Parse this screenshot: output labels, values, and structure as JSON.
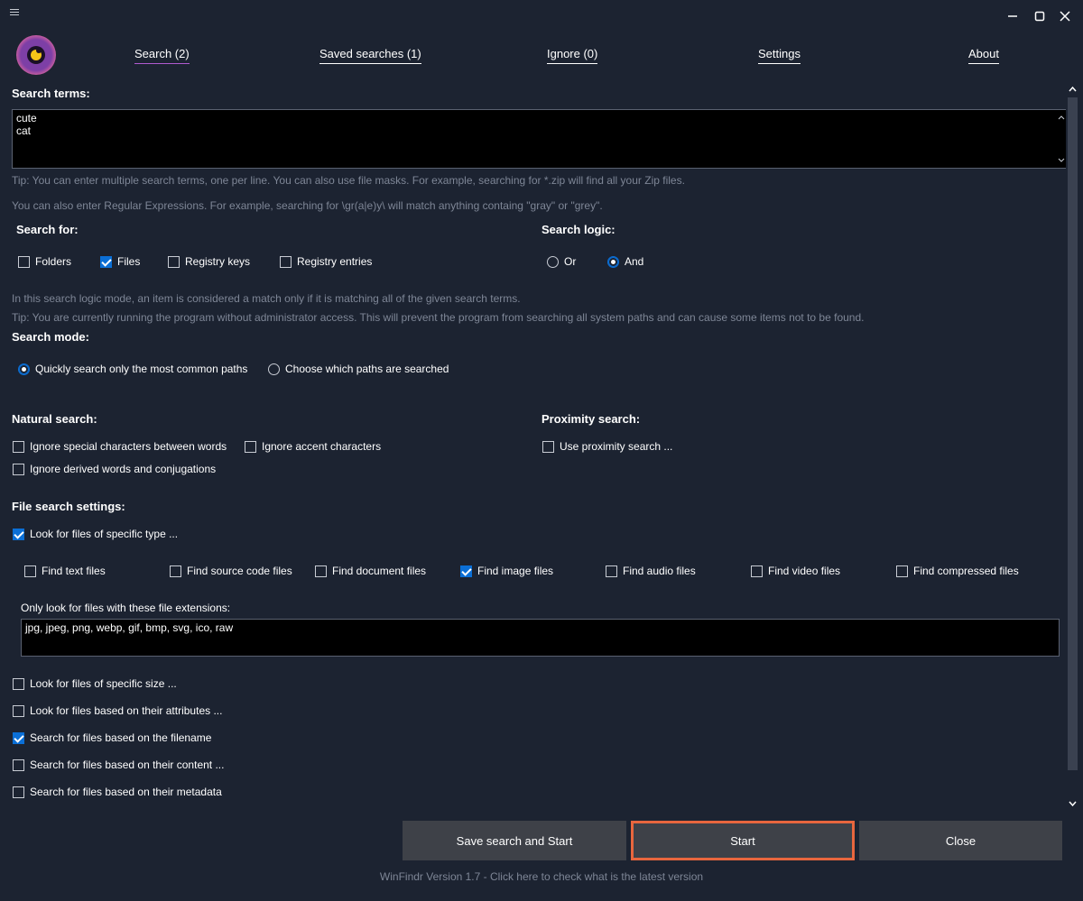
{
  "tabs": [
    {
      "label": "Search (2)"
    },
    {
      "label": "Saved searches (1)"
    },
    {
      "label": "Ignore (0)"
    },
    {
      "label": "Settings"
    },
    {
      "label": "About"
    }
  ],
  "search_terms": {
    "heading": "Search terms:",
    "value": "cute\ncat",
    "tip1": "Tip: You can enter multiple search terms, one per line. You can also use file masks. For example, searching for *.zip will find all your Zip files.",
    "tip2": "You can also enter Regular Expressions. For example, searching for \\gr(a|e)y\\ will match anything containg \"gray\" or \"grey\"."
  },
  "search_for": {
    "heading": "Search for:",
    "options": [
      {
        "label": "Folders",
        "checked": false
      },
      {
        "label": "Files",
        "checked": true
      },
      {
        "label": "Registry keys",
        "checked": false
      },
      {
        "label": "Registry entries",
        "checked": false
      }
    ]
  },
  "search_logic": {
    "heading": "Search logic:",
    "options": [
      {
        "label": "Or",
        "selected": false
      },
      {
        "label": "And",
        "selected": true
      }
    ],
    "info": "In this search logic mode, an item is considered a match only if it is matching all of the given search terms.",
    "admin_tip": "Tip: You are currently running the program without administrator access. This will prevent the program from searching all system paths and can cause some items not to be found."
  },
  "search_mode": {
    "heading": "Search mode:",
    "options": [
      {
        "label": "Quickly search only the most common paths",
        "selected": true
      },
      {
        "label": "Choose which paths are searched",
        "selected": false
      }
    ]
  },
  "natural_search": {
    "heading": "Natural search:",
    "options": [
      {
        "label": "Ignore special characters between words",
        "checked": false
      },
      {
        "label": "Ignore accent characters",
        "checked": false
      },
      {
        "label": "Ignore derived words and conjugations",
        "checked": false
      }
    ]
  },
  "proximity_search": {
    "heading": "Proximity search:",
    "options": [
      {
        "label": "Use proximity search ...",
        "checked": false
      }
    ]
  },
  "file_search": {
    "heading": "File search settings:",
    "specific_type": {
      "label": "Look for files of specific type ...",
      "checked": true
    },
    "types": [
      {
        "label": "Find text files",
        "checked": false
      },
      {
        "label": "Find source code files",
        "checked": false
      },
      {
        "label": "Find document files",
        "checked": false
      },
      {
        "label": "Find image files",
        "checked": true
      },
      {
        "label": "Find audio files",
        "checked": false
      },
      {
        "label": "Find video files",
        "checked": false
      },
      {
        "label": "Find compressed files",
        "checked": false
      }
    ],
    "extensions_label": "Only look for files with these file extensions:",
    "extensions_value": "jpg, jpeg, png, webp, gif, bmp, svg, ico, raw",
    "more": [
      {
        "label": "Look for files of specific size ...",
        "checked": false
      },
      {
        "label": "Look for files based on their attributes ...",
        "checked": false
      },
      {
        "label": "Search for files based on the filename",
        "checked": true
      },
      {
        "label": "Search for files based on their content ...",
        "checked": false
      },
      {
        "label": "Search for files based on their metadata",
        "checked": false
      }
    ]
  },
  "buttons": {
    "save_start": "Save search and Start",
    "start": "Start",
    "close": "Close"
  },
  "footer": "WinFindr Version 1.7 - Click here to check what is the latest version",
  "colors": {
    "accent": "#0b6fd6",
    "primary_border": "#e8663e",
    "background": "#1c2331"
  }
}
